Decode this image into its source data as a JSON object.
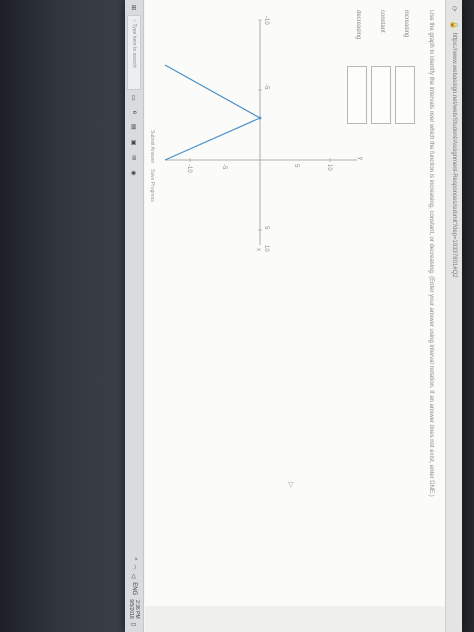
{
  "browser": {
    "url": "https://www.webassign.net/web/Student/Assignment-Responses/submit?dep=19337801#Q2"
  },
  "question": {
    "text": "Use the graph to identify the intervals over which the function is increasing, constant, or decreasing. (Enter your answer using interval notation. If an answer does not exist, enter DNE.)",
    "rows": [
      {
        "label": "increasing"
      },
      {
        "label": "constant"
      },
      {
        "label": "decreasing"
      }
    ]
  },
  "graph": {
    "x_ticks": [
      "-10",
      "-5",
      "5",
      "10"
    ],
    "y_ticks": [
      "10",
      "5",
      "-5",
      "-10"
    ],
    "x_axis_label": "x",
    "y_axis_label": "y"
  },
  "buttons": {
    "submit": "Submit Answer",
    "save": "Save Progress"
  },
  "taskbar": {
    "search_placeholder": "Type here to search",
    "lang": "ENG",
    "time": "2:36 PM",
    "date": "9/5/2018"
  },
  "colors": {
    "line": "#4a90c8",
    "text": "#8a8a8a"
  }
}
